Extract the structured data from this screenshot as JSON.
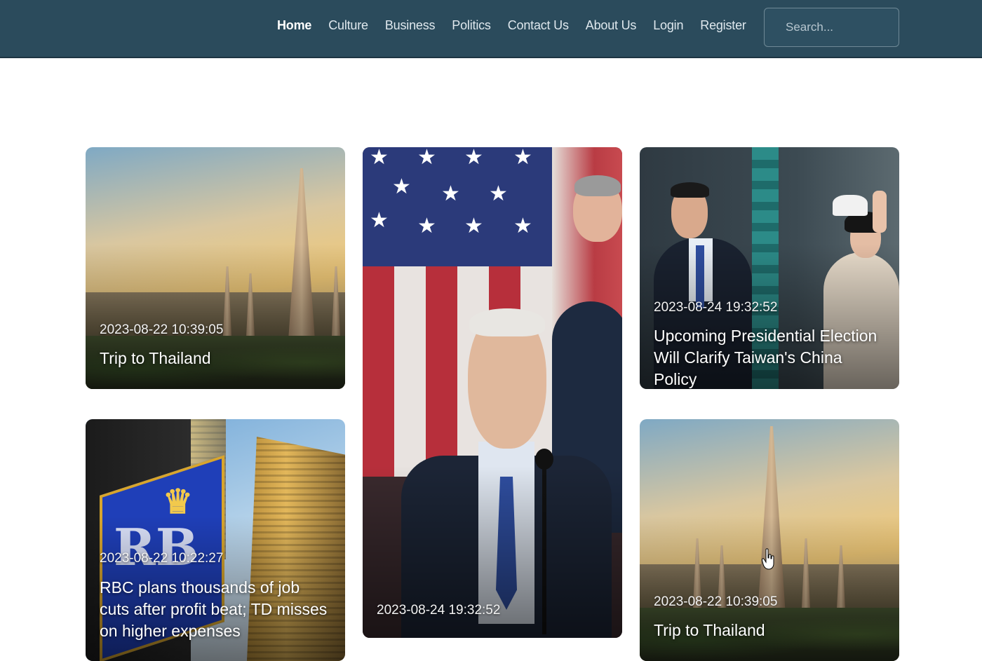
{
  "nav": {
    "items": [
      {
        "label": "Home",
        "active": true
      },
      {
        "label": "Culture"
      },
      {
        "label": "Business"
      },
      {
        "label": "Politics"
      },
      {
        "label": "Contact Us"
      },
      {
        "label": "About Us"
      },
      {
        "label": "Login"
      },
      {
        "label": "Register"
      }
    ],
    "search_placeholder": "Search..."
  },
  "cards": [
    {
      "date": "2023-08-22 10:39:05",
      "title": "Trip to Thailand",
      "image": "temple-photo"
    },
    {
      "date": "2023-08-24 19:32:52",
      "title": "",
      "image": "politics-photo"
    },
    {
      "date": "2023-08-24 19:32:52",
      "title": "Upcoming Presidential Election Will Clarify Taiwan's China Policy",
      "image": "taiwan-photo"
    },
    {
      "date": "2023-08-22 10:22:27",
      "title": "RBC plans thousands of job cuts after profit beat; TD misses on higher expenses",
      "image": "rbc-photo"
    },
    {
      "date": "2023-08-22 10:39:05",
      "title": "Trip to Thailand",
      "image": "temple-photo"
    }
  ],
  "colors": {
    "navbar": "#2b4b5c",
    "page_bg": "#ffffff"
  }
}
